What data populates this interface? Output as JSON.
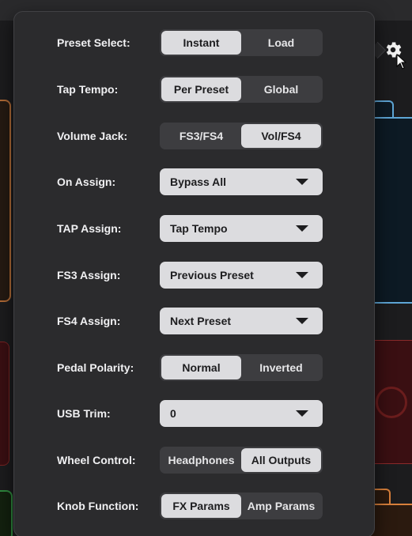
{
  "settings": {
    "preset_select": {
      "label": "Preset Select:",
      "options": [
        "Instant",
        "Load"
      ],
      "selected": 0
    },
    "tap_tempo": {
      "label": "Tap Tempo:",
      "options": [
        "Per Preset",
        "Global"
      ],
      "selected": 0
    },
    "volume_jack": {
      "label": "Volume Jack:",
      "options": [
        "FS3/FS4",
        "Vol/FS4"
      ],
      "selected": 1
    },
    "on_assign": {
      "label": "On Assign:",
      "value": "Bypass All"
    },
    "tap_assign": {
      "label": "TAP Assign:",
      "value": "Tap Tempo"
    },
    "fs3_assign": {
      "label": "FS3 Assign:",
      "value": "Previous Preset"
    },
    "fs4_assign": {
      "label": "FS4 Assign:",
      "value": "Next Preset"
    },
    "pedal_polarity": {
      "label": "Pedal Polarity:",
      "options": [
        "Normal",
        "Inverted"
      ],
      "selected": 0
    },
    "usb_trim": {
      "label": "USB Trim:",
      "value": "0"
    },
    "wheel_control": {
      "label": "Wheel Control:",
      "options": [
        "Headphones",
        "All Outputs"
      ],
      "selected": 1
    },
    "knob_function": {
      "label": "Knob Function:",
      "options": [
        "FX Params",
        "Amp Params"
      ],
      "selected": 0
    }
  },
  "icons": {
    "gear": "gear-icon",
    "caret": "chevron-down-icon",
    "cursor": "pointer-cursor-icon"
  },
  "colors": {
    "popover_bg": "#2b2b2d",
    "segment_bg": "#3d3d40",
    "selected_bg": "#dcdcdf",
    "accent_blue": "#5ea6d6",
    "accent_orange": "#d9803b",
    "accent_red": "#8a2a2a",
    "accent_green": "#2f8a3f"
  }
}
